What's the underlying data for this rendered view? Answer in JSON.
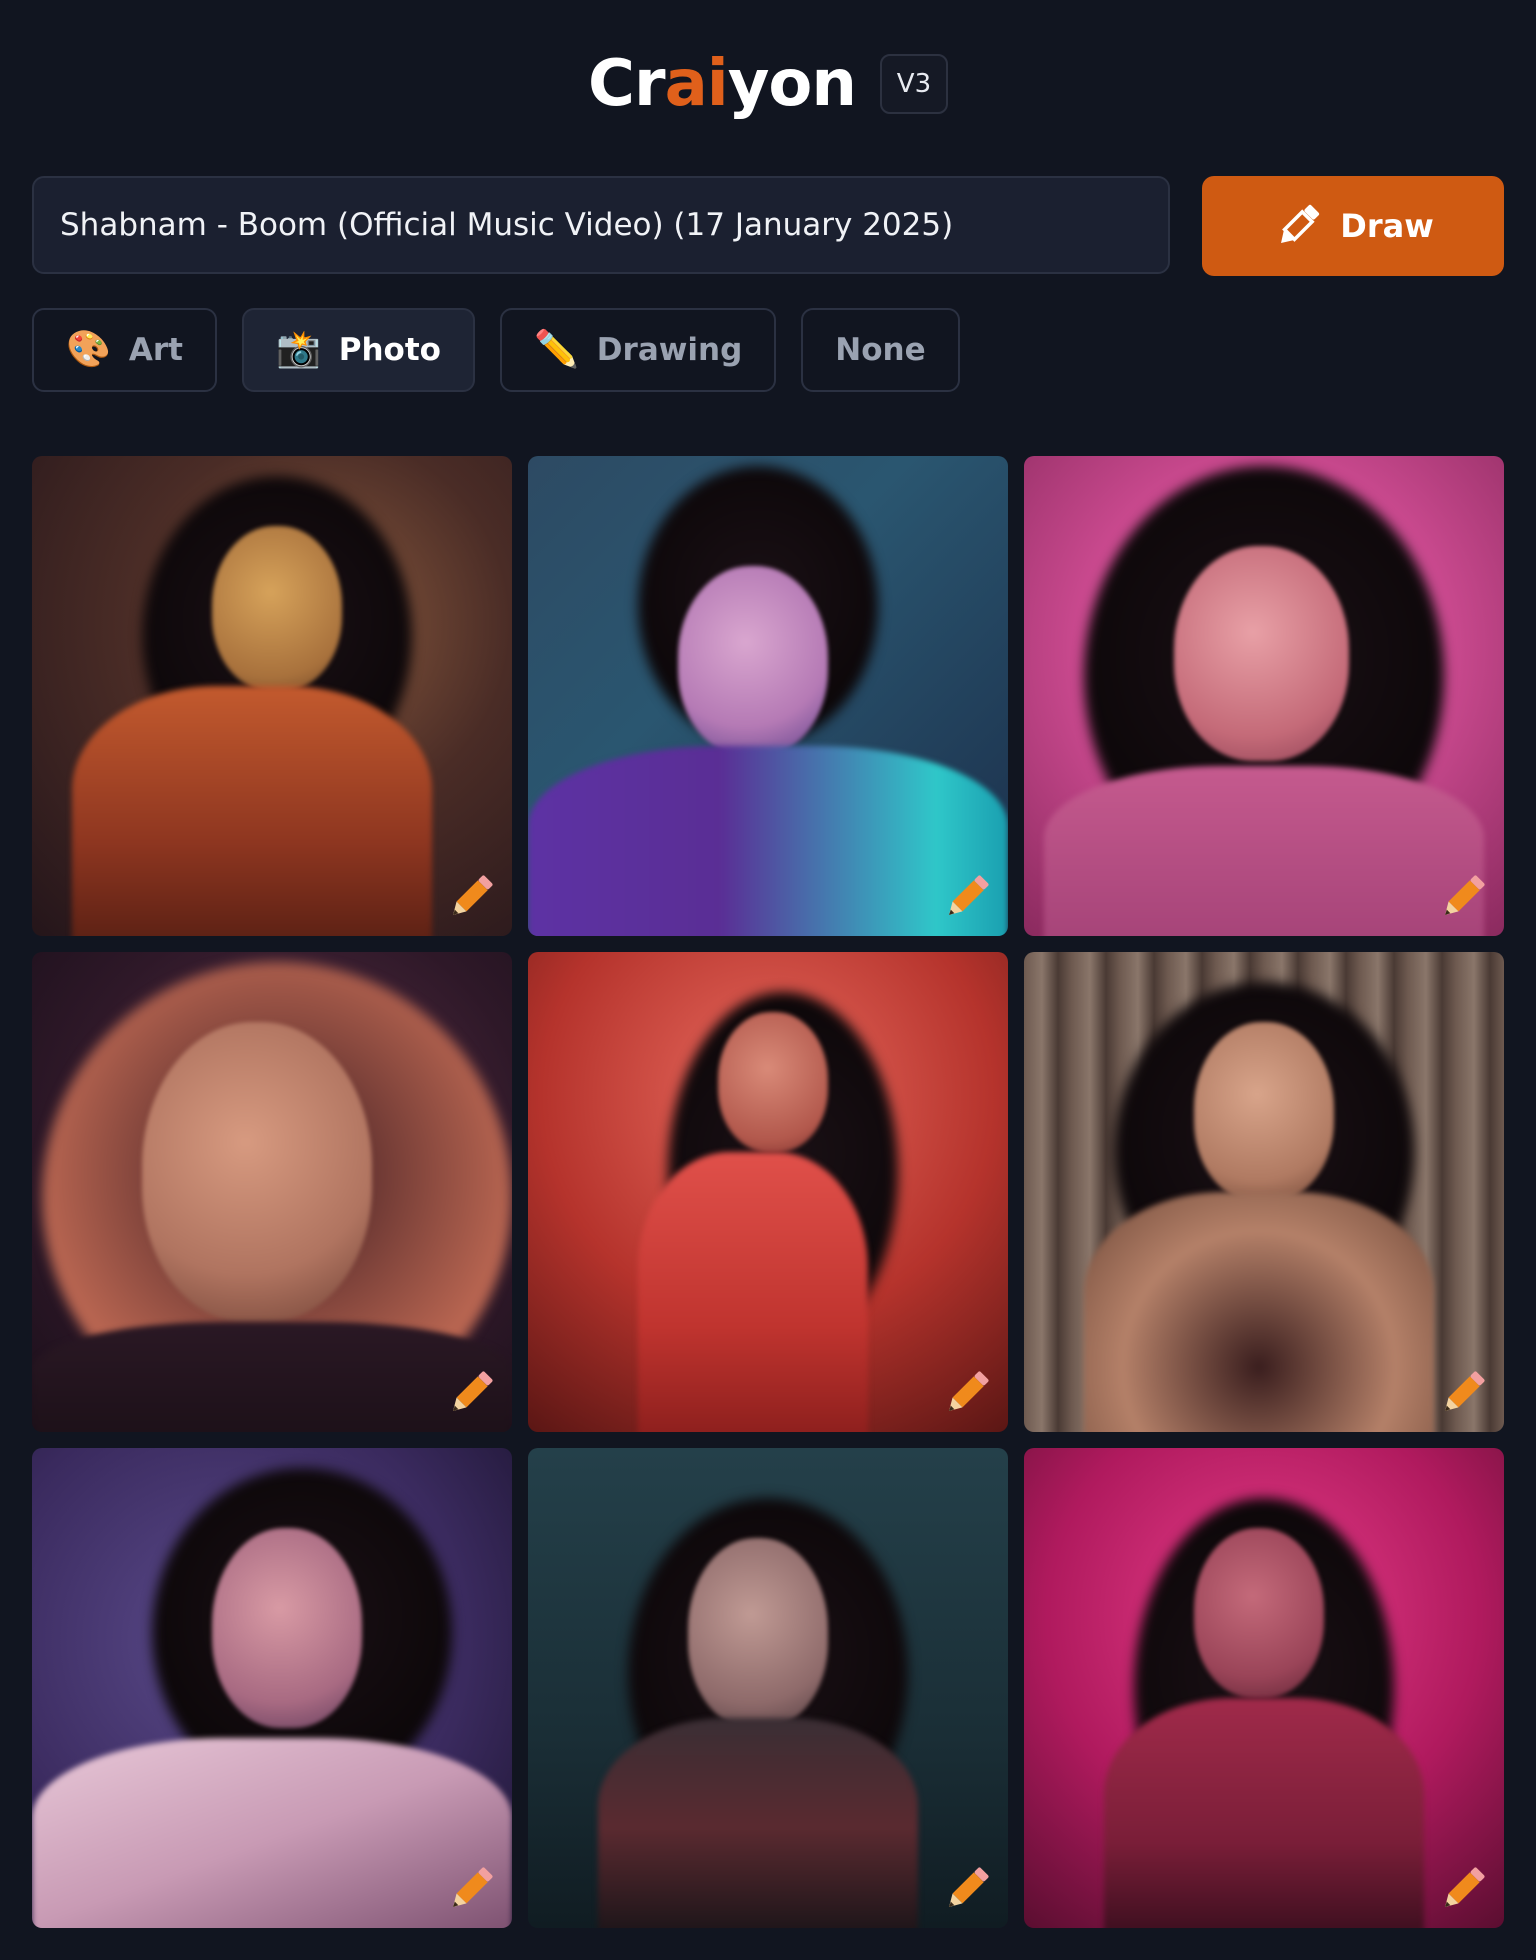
{
  "header": {
    "logo_part1": "Cr",
    "logo_part2": "ai",
    "logo_part3": "yon",
    "version": "V3"
  },
  "prompt": {
    "value": "Shabnam - Boom (Official Music Video) (17 January 2025)"
  },
  "draw_button": {
    "label": "Draw",
    "icon": "pencil-icon"
  },
  "styles": [
    {
      "emoji": "🎨",
      "label": "Art",
      "icon": "palette-icon",
      "active": false
    },
    {
      "emoji": "📸",
      "label": "Photo",
      "icon": "camera-flash-icon",
      "active": true
    },
    {
      "emoji": "✏️",
      "label": "Drawing",
      "icon": "pencil-icon",
      "active": false
    },
    {
      "emoji": "",
      "label": "None",
      "active": false
    }
  ],
  "colors": {
    "background": "#111520",
    "accent": "#cf5a12",
    "logo_ai": "#e0601b"
  },
  "images": [
    {
      "id": 1,
      "palette": "warm amber room"
    },
    {
      "id": 2,
      "palette": "teal and violet"
    },
    {
      "id": 3,
      "palette": "hot pink"
    },
    {
      "id": 4,
      "palette": "dim purple rim light"
    },
    {
      "id": 5,
      "palette": "red neon"
    },
    {
      "id": 6,
      "palette": "beige curtains"
    },
    {
      "id": 7,
      "palette": "violet haze"
    },
    {
      "id": 8,
      "palette": "dark teal"
    },
    {
      "id": 9,
      "palette": "magenta club"
    }
  ]
}
